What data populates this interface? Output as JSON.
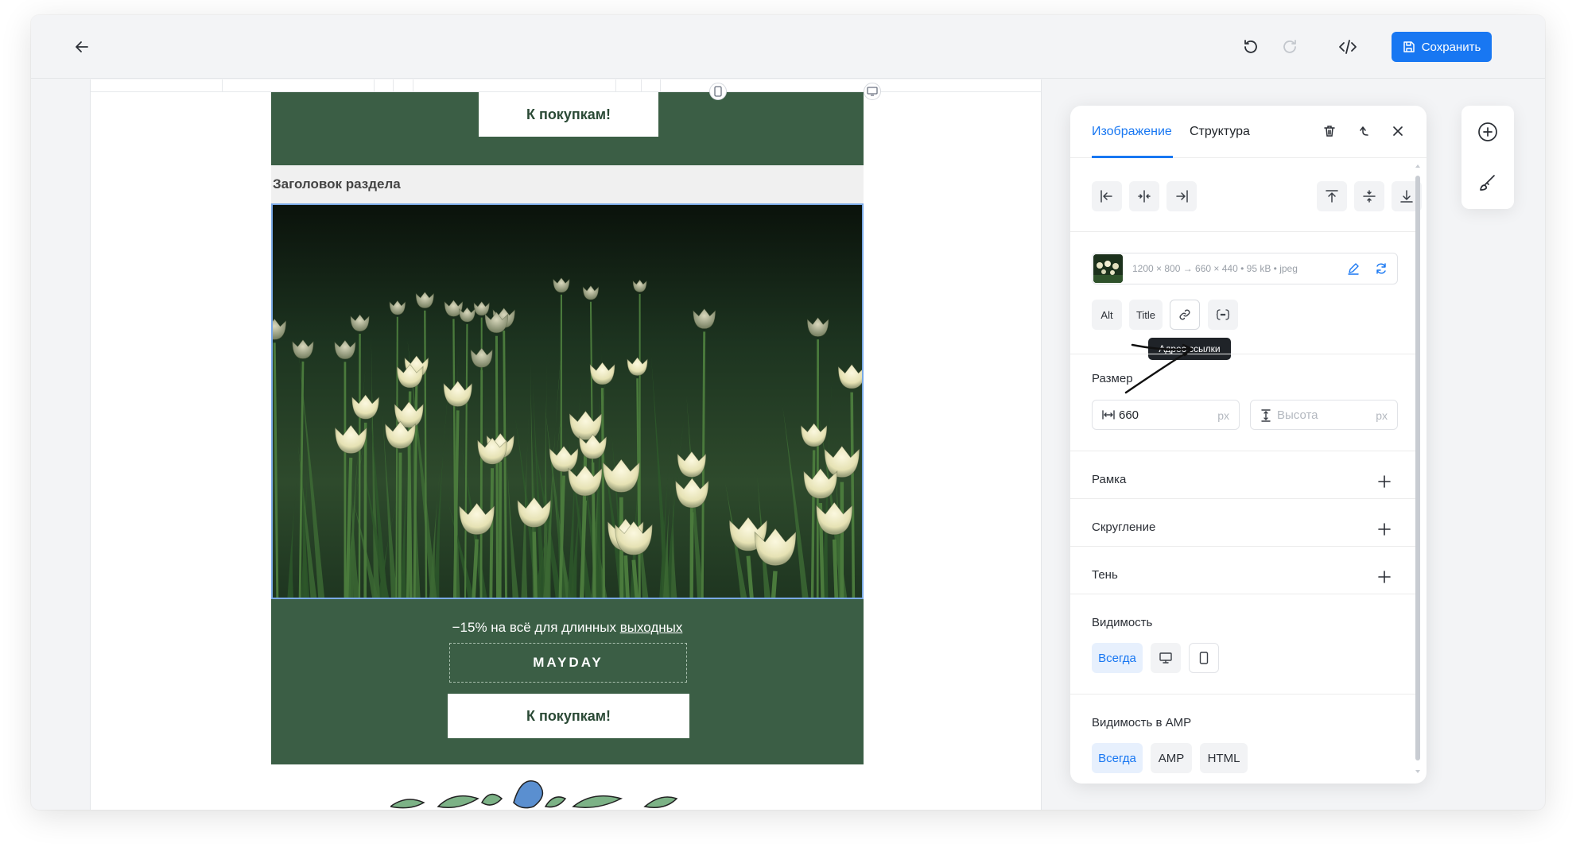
{
  "topbar": {
    "back_icon": "arrow-left-icon",
    "undo_icon": "undo-icon",
    "redo_icon": "redo-icon",
    "code_icon": "code-icon",
    "save_label": "Сохранить",
    "save_icon": "floppy-disk-icon"
  },
  "canvas": {
    "top_button_label": "К покупкам!",
    "section_title": "Заголовок раздела",
    "promo_text_prefix": "−15% на всё для длинных ",
    "promo_text_link": "выходных",
    "promo_code": "MAYDAY",
    "bottom_button_label": "К покупкам!",
    "colors": {
      "green": "#3b5e45",
      "selection": "#7aa9e6"
    }
  },
  "panel": {
    "tabs": [
      {
        "label": "Изображение",
        "active": true
      },
      {
        "label": "Структура",
        "active": false
      }
    ],
    "header_icons": [
      "trash-icon",
      "parent-arrow-icon",
      "close-icon"
    ],
    "align_icons": [
      "align-left-icon",
      "align-center-h-icon",
      "align-right-icon",
      "align-top-icon",
      "align-middle-v-icon",
      "align-bottom-icon"
    ],
    "image_meta": "1200 × 800 → 660 × 440  •  95 kB  •  jpeg",
    "chips": {
      "alt": "Alt",
      "title": "Title"
    },
    "tooltip": "Адрес ссылки",
    "size": {
      "label": "Размер",
      "width_value": "660",
      "width_unit": "px",
      "height_placeholder": "Высота",
      "height_unit": "px"
    },
    "sections": {
      "border": "Рамка",
      "radius": "Скругление",
      "shadow": "Тень"
    },
    "visibility": {
      "label": "Видимость",
      "always": "Всегда"
    },
    "amp_visibility": {
      "label": "Видимость в AMP",
      "always": "Всегда",
      "amp": "AMP",
      "html": "HTML"
    },
    "accent": "#1877f2"
  },
  "mini_toolbar": [
    "add-circle-icon",
    "brush-icon"
  ]
}
